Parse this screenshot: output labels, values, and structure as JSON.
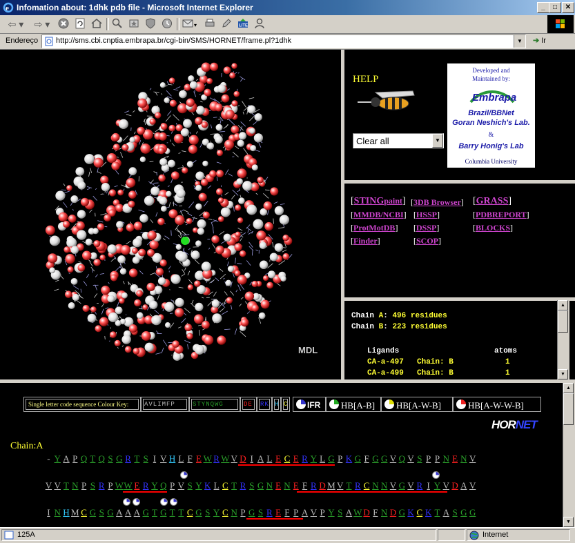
{
  "window": {
    "title": "Infomation about: 1dhk pdb file - Microsoft Internet Explorer",
    "min": "_",
    "max": "□",
    "close": "✕"
  },
  "address": {
    "label": "Endereço",
    "url": "http://sms.cbi.cnptia.embrapa.br/cgi-bin/SMS/HORNET/frame.pl?1dhk",
    "go_label": "Ir"
  },
  "molecule": {
    "logo": "MDL"
  },
  "help": {
    "title": "HELP",
    "select_value": "Clear all"
  },
  "developed": {
    "line1": "Developed and",
    "line2": "Maintained by:",
    "embrapa": "Embrapa",
    "lab1a": "Brazil/BBNet",
    "lab1b": "Goran Neshich's Lab.",
    "amp": "&",
    "lab2": "Barry Honig's Lab",
    "univ": "Columbia University"
  },
  "links": {
    "sting": "STING",
    "paint": "paint",
    "browser3d": "3DB Browser",
    "grass": "GRASS",
    "mmdb": "MMDB/NCBI",
    "hssp": "HSSP",
    "pdbreport": "PDBREPORT",
    "protmotdb": "ProtMotDB",
    "dssp": "DSSP",
    "blocks": "BLOCKS",
    "finder": "Finder",
    "scop": "SCOP"
  },
  "chains": {
    "a_label": "Chain",
    "a_id": "A",
    "a_count": "496",
    "a_unit": "residues",
    "b_label": "Chain",
    "b_id": "B",
    "b_count": "223",
    "b_unit": "residues",
    "ligands_header": "Ligands",
    "atoms_header": "atoms",
    "ligands": [
      {
        "name": "CA-a-497",
        "chain": "Chain: B",
        "atoms": "1"
      },
      {
        "name": "CA-a-499",
        "chain": "Chain: B",
        "atoms": "1"
      }
    ]
  },
  "key": {
    "label": "Single letter code sequence Colour Key:",
    "gray": "AVLIMFP",
    "green": "STYNQWG",
    "red": "DE",
    "blue": "RK",
    "h": "H",
    "c": "C"
  },
  "legend": {
    "ifr": "IFR",
    "hb1": "HB[A-B]",
    "hb2": "HB[A-W-B]",
    "hb3": "HB[A-W-W-B]"
  },
  "hornet": {
    "part1": "HOR",
    "part2": "NET"
  },
  "sequence": {
    "chain_label": "Chain:A",
    "line1": "-YAPQTQSGRTSIVHLFEWRWVDIALECERYLGPKGFGGVQVSPPNENV",
    "line2": "VVTNPSRPWWERYQPVSYKLCTRSGNENEFRDMVTRCNNVGVRIYVDAV",
    "line3": "INHMCGSGAAAGTGTTCGSYCNPGSREFPAVPYSAWDFNDGKCKTASGG"
  },
  "status": {
    "text": "125A",
    "zone": "Internet"
  },
  "colors": {
    "gray": "#bbbbbb",
    "green": "#2aa02a",
    "red": "#ff2020",
    "blue": "#3333ff",
    "cyan": "#33ccff",
    "yellow": "#ffff33"
  }
}
